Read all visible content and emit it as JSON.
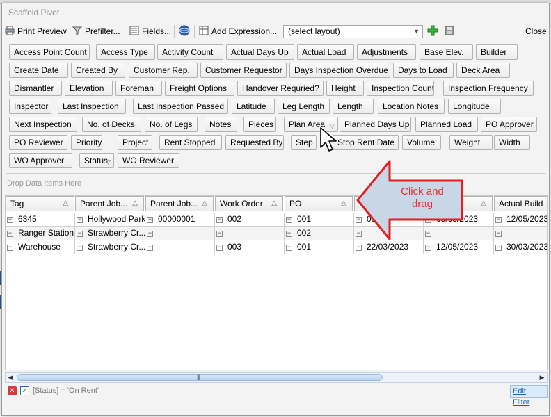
{
  "window": {
    "title": "Scaffold Pivot"
  },
  "toolbar": {
    "print_preview": "Print Preview",
    "prefilter": "Prefilter...",
    "fields": "Fields...",
    "add_expression": "Add Expression...",
    "layout_value": "(select layout)",
    "close": "Close"
  },
  "fields": [
    "Access Point Count",
    "Access Type",
    "Activity Count",
    "Actual Days Up",
    "Actual Load",
    "Adjustments",
    "Base Elev.",
    "Builder",
    "Create Date",
    "Created By",
    "Customer Rep.",
    "Customer Requestor",
    "Days Inspection Overdue",
    "Days to Load",
    "Deck Area",
    "Dismantler",
    "Elevation",
    "Foreman",
    "Freight Options",
    "Handover Requried?",
    "Height",
    "Inspection Count",
    "Inspection Frequency",
    "Inspector",
    "Last Inspection",
    "Last Inspection Passed",
    "Latitude",
    "Leg Length",
    "Length",
    "Location Notes",
    "Longitude",
    "Next Inspection",
    "No. of Decks",
    "No. of Legs",
    "Notes",
    "Pieces",
    "Plan Area",
    "Planned Days Up",
    "Planned Load",
    "PO Approver",
    "PO Reviewer",
    "Priority",
    "Project",
    "Rent Stopped",
    "Requested By",
    "Step",
    "Stop Rent Date",
    "Volume",
    "Weight",
    "Width",
    "WO Approver",
    "Status",
    "WO Reviewer"
  ],
  "drop_hint": "Drop Data Items Here",
  "grid": {
    "columns": [
      "Tag",
      "Parent Job...",
      "Parent Job...",
      "Work Order",
      "PO",
      "",
      "",
      "Actual Build"
    ],
    "rows": [
      [
        "6345",
        "Hollywood Park",
        "00000001",
        "002",
        "001",
        "03/...",
        "05/05/2023",
        "12/05/2023"
      ],
      [
        "Ranger Station",
        "Strawberry Cr...",
        "",
        "",
        "002",
        "",
        "",
        ""
      ],
      [
        "Warehouse",
        "Strawberry Cr...",
        "",
        "003",
        "001",
        "22/03/2023",
        "12/05/2023",
        "30/03/2023"
      ]
    ]
  },
  "filter": {
    "expression": "[Status] = 'On Rent'",
    "edit_label": "Edit Filter"
  },
  "callout": {
    "text_line1": "Click and",
    "text_line2": "drag",
    "fill_color": "#c8d6e6",
    "stroke_color": "#e02020"
  },
  "colors": {
    "accent_blue": "#2163ad",
    "filter_red": "#d9363e"
  }
}
